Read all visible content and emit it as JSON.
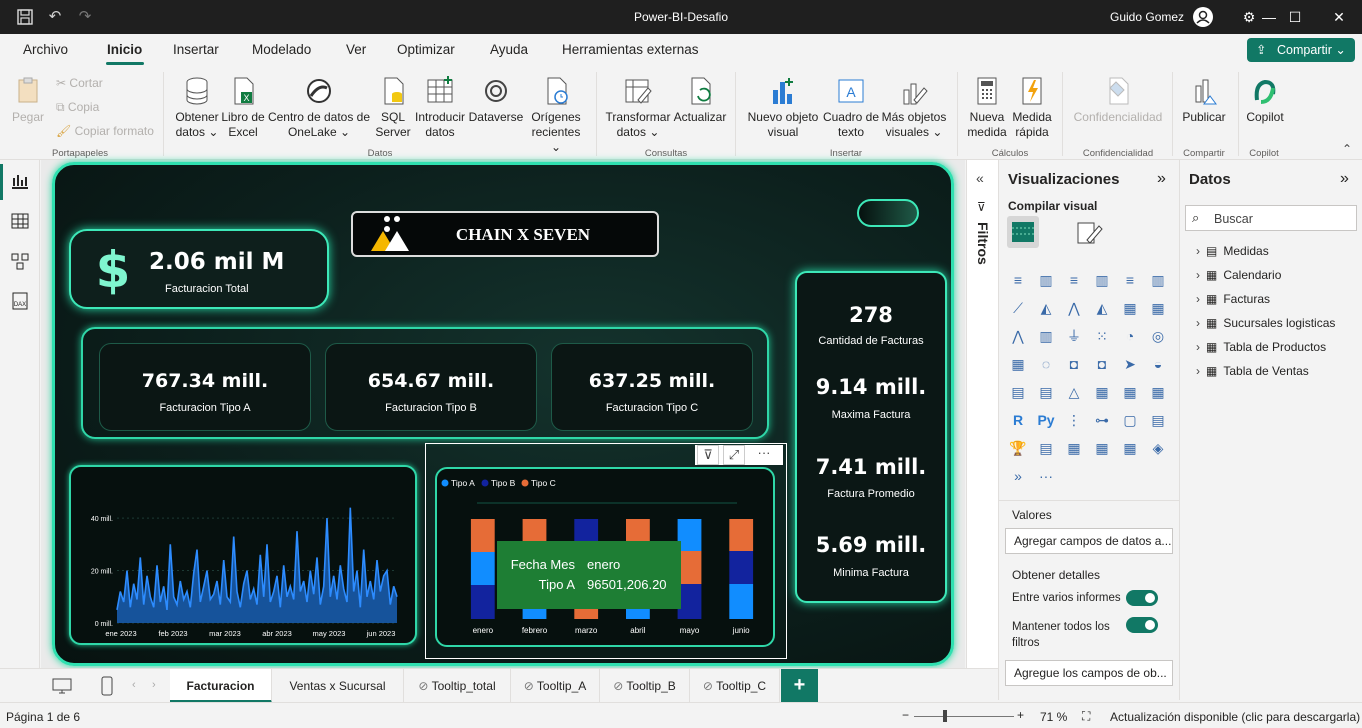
{
  "app": {
    "title": "Power-BI-Desafio",
    "user": "Guido Gomez"
  },
  "menu": {
    "tabs": [
      "Archivo",
      "Inicio",
      "Insertar",
      "Modelado",
      "Ver",
      "Optimizar",
      "Ayuda",
      "Herramientas externas"
    ],
    "share": "Compartir"
  },
  "ribbon": {
    "paste": "Pegar",
    "cut": "Cortar",
    "copy": "Copia",
    "format_copy": "Copiar formato",
    "get_data_1": "Obtener",
    "get_data_2": "datos ⌄",
    "excel_1": "Libro de",
    "excel_2": "Excel",
    "onelake_1": "Centro de datos de",
    "onelake_2": "OneLake ⌄",
    "sql_1": "SQL",
    "sql_2": "Server",
    "enter_1": "Introducir",
    "enter_2": "datos",
    "dataverse": "Dataverse",
    "recent_1": "Orígenes",
    "recent_2": "recientes ⌄",
    "transform_1": "Transformar",
    "transform_2": "datos ⌄",
    "refresh": "Actualizar",
    "newvisual_1": "Nuevo objeto",
    "newvisual_2": "visual",
    "textbox_1": "Cuadro de",
    "textbox_2": "texto",
    "morevisuals_1": "Más objetos",
    "morevisuals_2": "visuales ⌄",
    "newmeasure_1": "Nueva",
    "newmeasure_2": "medida",
    "quickmeasure_1": "Medida",
    "quickmeasure_2": "rápida",
    "sensitivity": "Confidencialidad",
    "publish": "Publicar",
    "copilot": "Copilot",
    "groups": {
      "clipboard": "Portapapeles",
      "data": "Datos",
      "queries": "Consultas",
      "insert": "Insertar",
      "calc": "Cálculos",
      "sens": "Confidencialidad",
      "share": "Compartir",
      "copilot": "Copilot"
    }
  },
  "report": {
    "brand": "CHAIN X SEVEN",
    "total": {
      "value": "2.06 mil M",
      "label": "Facturacion Total"
    },
    "tipo_a": {
      "value": "767.34 mill.",
      "label": "Facturacion Tipo A"
    },
    "tipo_b": {
      "value": "654.67 mill.",
      "label": "Facturacion Tipo B"
    },
    "tipo_c": {
      "value": "637.25 mill.",
      "label": "Facturacion Tipo C"
    },
    "count": {
      "value": "278",
      "label": "Cantidad de Facturas"
    },
    "max": {
      "value": "9.14 mill.",
      "label": "Maxima Factura"
    },
    "avg": {
      "value": "7.41 mill.",
      "label": "Factura Promedio"
    },
    "min": {
      "value": "5.69 mill.",
      "label": "Minima Factura"
    },
    "tooltip": {
      "k1": "Fecha Mes",
      "v1": "enero",
      "k2": "Tipo A",
      "v2": "96501,206.20"
    }
  },
  "chart_data": [
    {
      "type": "area",
      "x_labels": [
        "ene 2023",
        "feb 2023",
        "mar 2023",
        "abr 2023",
        "may 2023",
        "jun 2023"
      ],
      "y_ticks": [
        "0 mill.",
        "20 mill.",
        "40 mill."
      ],
      "ylim": [
        0,
        45
      ],
      "series": [
        {
          "values": [
            5,
            12,
            8,
            20,
            6,
            15,
            9,
            25,
            7,
            18,
            10,
            6,
            22,
            8,
            14,
            5,
            30,
            10,
            7,
            16,
            9,
            12,
            6,
            19,
            28,
            8,
            14,
            20,
            9,
            11,
            16,
            7,
            24,
            10,
            8,
            33,
            12,
            6,
            15,
            20,
            9,
            13,
            7,
            26,
            10,
            30,
            8,
            12,
            18,
            6,
            22,
            10,
            14,
            9,
            35,
            12,
            16,
            8,
            20,
            11,
            25,
            7,
            14,
            40,
            10,
            18,
            9,
            22,
            13,
            8,
            44,
            12,
            20,
            6,
            28,
            10,
            16,
            9,
            24,
            12,
            18,
            20,
            7,
            14,
            10
          ]
        }
      ]
    },
    {
      "type": "bar",
      "categories": [
        "enero",
        "febrero",
        "marzo",
        "abril",
        "mayo",
        "junio"
      ],
      "series": [
        {
          "name": "Tipo A",
          "values": [
            33,
            36,
            33,
            34,
            32,
            35
          ],
          "color": "#118dff"
        },
        {
          "name": "Tipo B",
          "values": [
            34,
            32,
            33,
            33,
            35,
            33
          ],
          "color": "#12239e"
        },
        {
          "name": "Tipo C",
          "values": [
            33,
            32,
            34,
            33,
            33,
            32
          ],
          "color": "#e66c37"
        }
      ]
    }
  ],
  "filters": {
    "label": "Filtros"
  },
  "viz": {
    "title": "Visualizaciones",
    "build": "Compilar visual",
    "values": "Valores",
    "add_fields": "Agregar campos de datos a...",
    "details": "Obtener detalles",
    "cross_report": "Entre varios informes",
    "keep_filters_1": "Mantener todos los",
    "keep_filters_2": "filtros",
    "add_drill": "Agregue los campos de ob..."
  },
  "datos": {
    "title": "Datos",
    "search": "Buscar",
    "tables": [
      "Medidas",
      "Calendario",
      "Facturas",
      "Sucursales logisticas",
      "Tabla de Productos",
      "Tabla de Ventas"
    ]
  },
  "pages": {
    "tabs": [
      "Facturacion",
      "Ventas x Sucursal",
      "Tooltip_total",
      "Tooltip_A",
      "Tooltip_B",
      "Tooltip_C"
    ]
  },
  "status": {
    "page": "Página 1 de 6",
    "zoom": "71 %",
    "update": "Actualización disponible (clic para descargarla)"
  }
}
